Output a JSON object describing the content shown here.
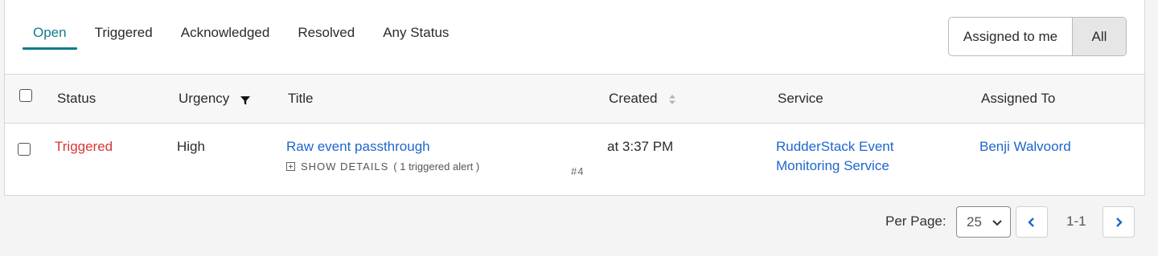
{
  "tabs": [
    "Open",
    "Triggered",
    "Acknowledged",
    "Resolved",
    "Any Status"
  ],
  "active_tab": "Open",
  "assign_toggle": {
    "mine": "Assigned to me",
    "all": "All",
    "selected": "All"
  },
  "table": {
    "headers": {
      "status": "Status",
      "urgency": "Urgency",
      "title": "Title",
      "created": "Created",
      "service": "Service",
      "assigned": "Assigned To"
    },
    "rows": [
      {
        "status": "Triggered",
        "urgency": "High",
        "title": "Raw event passthrough",
        "details_label": "SHOW DETAILS",
        "details_sub": "( 1 triggered alert )",
        "number": "#4",
        "created": "at 3:37 PM",
        "service_line1": "RudderStack Event",
        "service_line2": "Monitoring Service",
        "assigned_to": "Benji Walvoord"
      }
    ]
  },
  "pagination": {
    "per_page_label": "Per Page:",
    "per_page_value": "25",
    "range": "1-1"
  },
  "colors": {
    "accent": "#117a8b",
    "link": "#1f66cc",
    "triggered": "#d93737"
  }
}
